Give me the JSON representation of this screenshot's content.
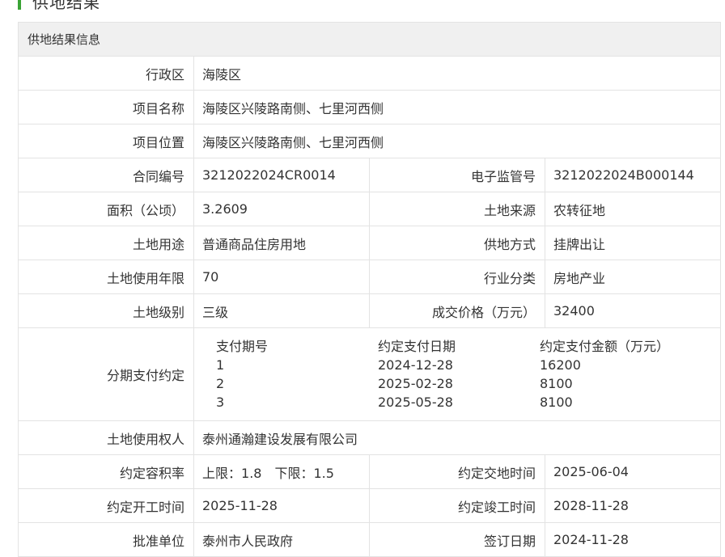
{
  "section": {
    "title": "供地结果"
  },
  "table": {
    "header": "供地结果信息",
    "district": {
      "label": "行政区",
      "value": "海陵区"
    },
    "project_name": {
      "label": "项目名称",
      "value": "海陵区兴陵路南侧、七里河西侧"
    },
    "project_location": {
      "label": "项目位置",
      "value": "海陵区兴陵路南侧、七里河西侧"
    },
    "contract_no": {
      "label": "合同编号",
      "value": "3212022024CR0014"
    },
    "e_supervision_no": {
      "label": "电子监管号",
      "value": "3212022024B000144"
    },
    "area": {
      "label": "面积（公顷）",
      "value": "3.2609"
    },
    "land_source": {
      "label": "土地来源",
      "value": "农转征地"
    },
    "land_use": {
      "label": "土地用途",
      "value": "普通商品住房用地"
    },
    "supply_method": {
      "label": "供地方式",
      "value": "挂牌出让"
    },
    "use_term": {
      "label": "土地使用年限",
      "value": "70"
    },
    "industry": {
      "label": "行业分类",
      "value": "房地产业"
    },
    "land_grade": {
      "label": "土地级别",
      "value": "三级"
    },
    "deal_price": {
      "label": "成交价格（万元）",
      "value": "32400"
    },
    "installment": {
      "label": "分期支付约定",
      "columns": [
        "支付期号",
        "约定支付日期",
        "约定支付金额（万元）"
      ],
      "rows": [
        [
          "1",
          "2024-12-28",
          "16200"
        ],
        [
          "2",
          "2025-02-28",
          "8100"
        ],
        [
          "3",
          "2025-05-28",
          "8100"
        ]
      ]
    },
    "right_holder": {
      "label": "土地使用权人",
      "value": "泰州通瀚建设发展有限公司"
    },
    "plot_ratio": {
      "label": "约定容积率",
      "upper_label": "上限：",
      "upper": "1.8",
      "lower_label": "下限：",
      "lower": "1.5"
    },
    "handover_time": {
      "label": "约定交地时间",
      "value": "2025-06-04"
    },
    "start_time": {
      "label": "约定开工时间",
      "value": "2025-11-28"
    },
    "completion_time": {
      "label": "约定竣工时间",
      "value": "2028-11-28"
    },
    "approval_unit": {
      "label": "批准单位",
      "value": "泰州市人民政府"
    },
    "sign_date": {
      "label": "签订日期",
      "value": "2024-11-28"
    }
  },
  "colors": {
    "accent": "#3aa335",
    "header_bg": "#f0f0f0",
    "border": "#e3e3e3",
    "text": "#333333"
  }
}
